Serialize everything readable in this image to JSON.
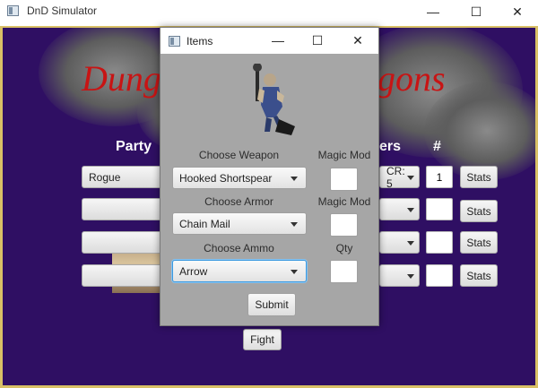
{
  "window": {
    "title": "DnD Simulator",
    "minimize": "—",
    "maximize": "☐",
    "close": "✕"
  },
  "main": {
    "banner_left": "Dung",
    "banner_right": "gons",
    "party_heading": "Party",
    "monsters_heading": "ers",
    "count_heading": "#",
    "party_slots": [
      "Rogue",
      "",
      "",
      ""
    ],
    "monster_selects": [
      "CR: 5",
      "",
      "",
      ""
    ],
    "monster_counts": [
      "1",
      "",
      "",
      ""
    ],
    "stats_label": "Stats",
    "fight_label": "Fight"
  },
  "dialog": {
    "title": "Items",
    "minimize": "—",
    "maximize": "☐",
    "close": "✕",
    "weapon_label": "Choose Weapon",
    "weapon_value": "Hooked Shortspear",
    "weapon_mod_label": "Magic Mod",
    "armor_label": "Choose Armor",
    "armor_value": "Chain Mail",
    "armor_mod_label": "Magic Mod",
    "ammo_label": "Choose Ammo",
    "ammo_value": "Arrow",
    "qty_label": "Qty",
    "submit_label": "Submit"
  },
  "colors": {
    "background": "#2f0f63",
    "banner": "#c81414",
    "frame": "#d9c066",
    "dialog": "#a6a6a6"
  }
}
